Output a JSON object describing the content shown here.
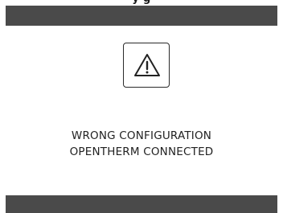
{
  "header": {
    "title": "y g"
  },
  "dialog": {
    "icon": "warning-triangle-icon",
    "message_line_1": "WRONG CONFIGURATION",
    "message_line_2": "OPENTHERM CONNECTED"
  },
  "colors": {
    "bar": "#4a4a4a",
    "background": "#ffffff",
    "text": "#222222"
  }
}
